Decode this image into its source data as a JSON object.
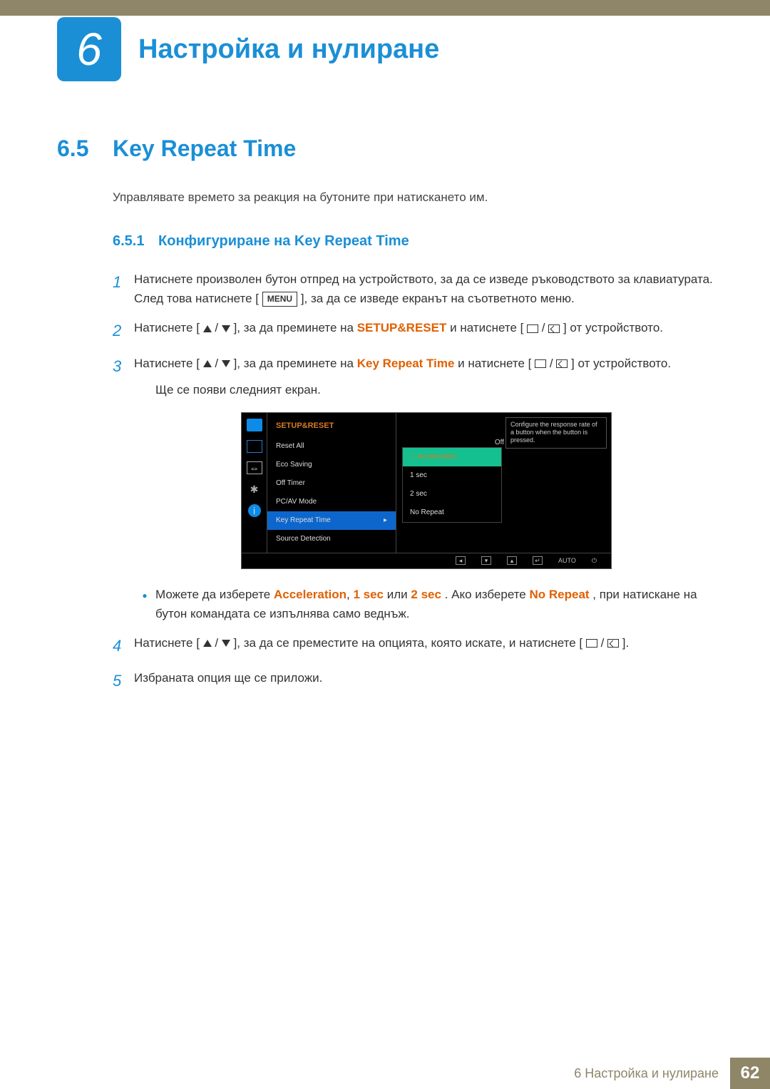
{
  "chapter": {
    "number": "6",
    "title": "Настройка и нулиране"
  },
  "section": {
    "number": "6.5",
    "title": "Key Repeat Time"
  },
  "intro": "Управлявате времето за реакция на бутоните при натискането им.",
  "subsection": {
    "number": "6.5.1",
    "title": "Конфигуриране на Key Repeat Time"
  },
  "menu_label": "MENU",
  "steps": {
    "s1": {
      "num": "1",
      "a": "Натиснете произволен бутон отпред на устройството, за да се изведе ръководството за клавиатурата. След това натиснете [",
      "b": "], за да се изведе екранът на съответното меню."
    },
    "s2": {
      "num": "2",
      "a": "Натиснете [",
      "b": "], за да преминете на ",
      "setup": "SETUP&RESET",
      "c": " и натиснете [",
      "d": "] от устройството."
    },
    "s3": {
      "num": "3",
      "a": "Натиснете [",
      "b": "], за да преминете на ",
      "key": "Key Repeat Time",
      "c": " и натиснете [",
      "d": "] от устройството.",
      "note": "Ще се появи следният екран."
    },
    "bullet": {
      "a": "Можете да изберете ",
      "accel": "Acceleration",
      "comma": ", ",
      "one": "1 sec",
      "or": " или ",
      "two": "2 sec",
      "b": ". Ако изберете ",
      "nr": "No Repeat",
      "c": ", при натискане на бутон командата се изпълнява само веднъж."
    },
    "s4": {
      "num": "4",
      "a": "Натиснете [",
      "b": "], за да се преместите на опцията, която искате, и натиснете [",
      "c": "]."
    },
    "s5": {
      "num": "5",
      "a": "Избраната опция ще се приложи."
    }
  },
  "osd": {
    "header": "SETUP&RESET",
    "items": {
      "reset": "Reset All",
      "eco": "Eco Saving",
      "eco_val": "Off",
      "offtimer": "Off Timer",
      "pcav": "PC/AV Mode",
      "key": "Key Repeat Time",
      "source": "Source Detection"
    },
    "popup": {
      "accel_check": "✓",
      "accel": "Acceleration",
      "one": "1 sec",
      "two": "2 sec",
      "no": "No Repeat"
    },
    "tip": "Configure the response rate of a button when the button is pressed.",
    "off_label": "Off",
    "footer": {
      "auto": "AUTO"
    }
  },
  "footer": {
    "text": "6 Настройка и нулиране",
    "page": "62"
  }
}
